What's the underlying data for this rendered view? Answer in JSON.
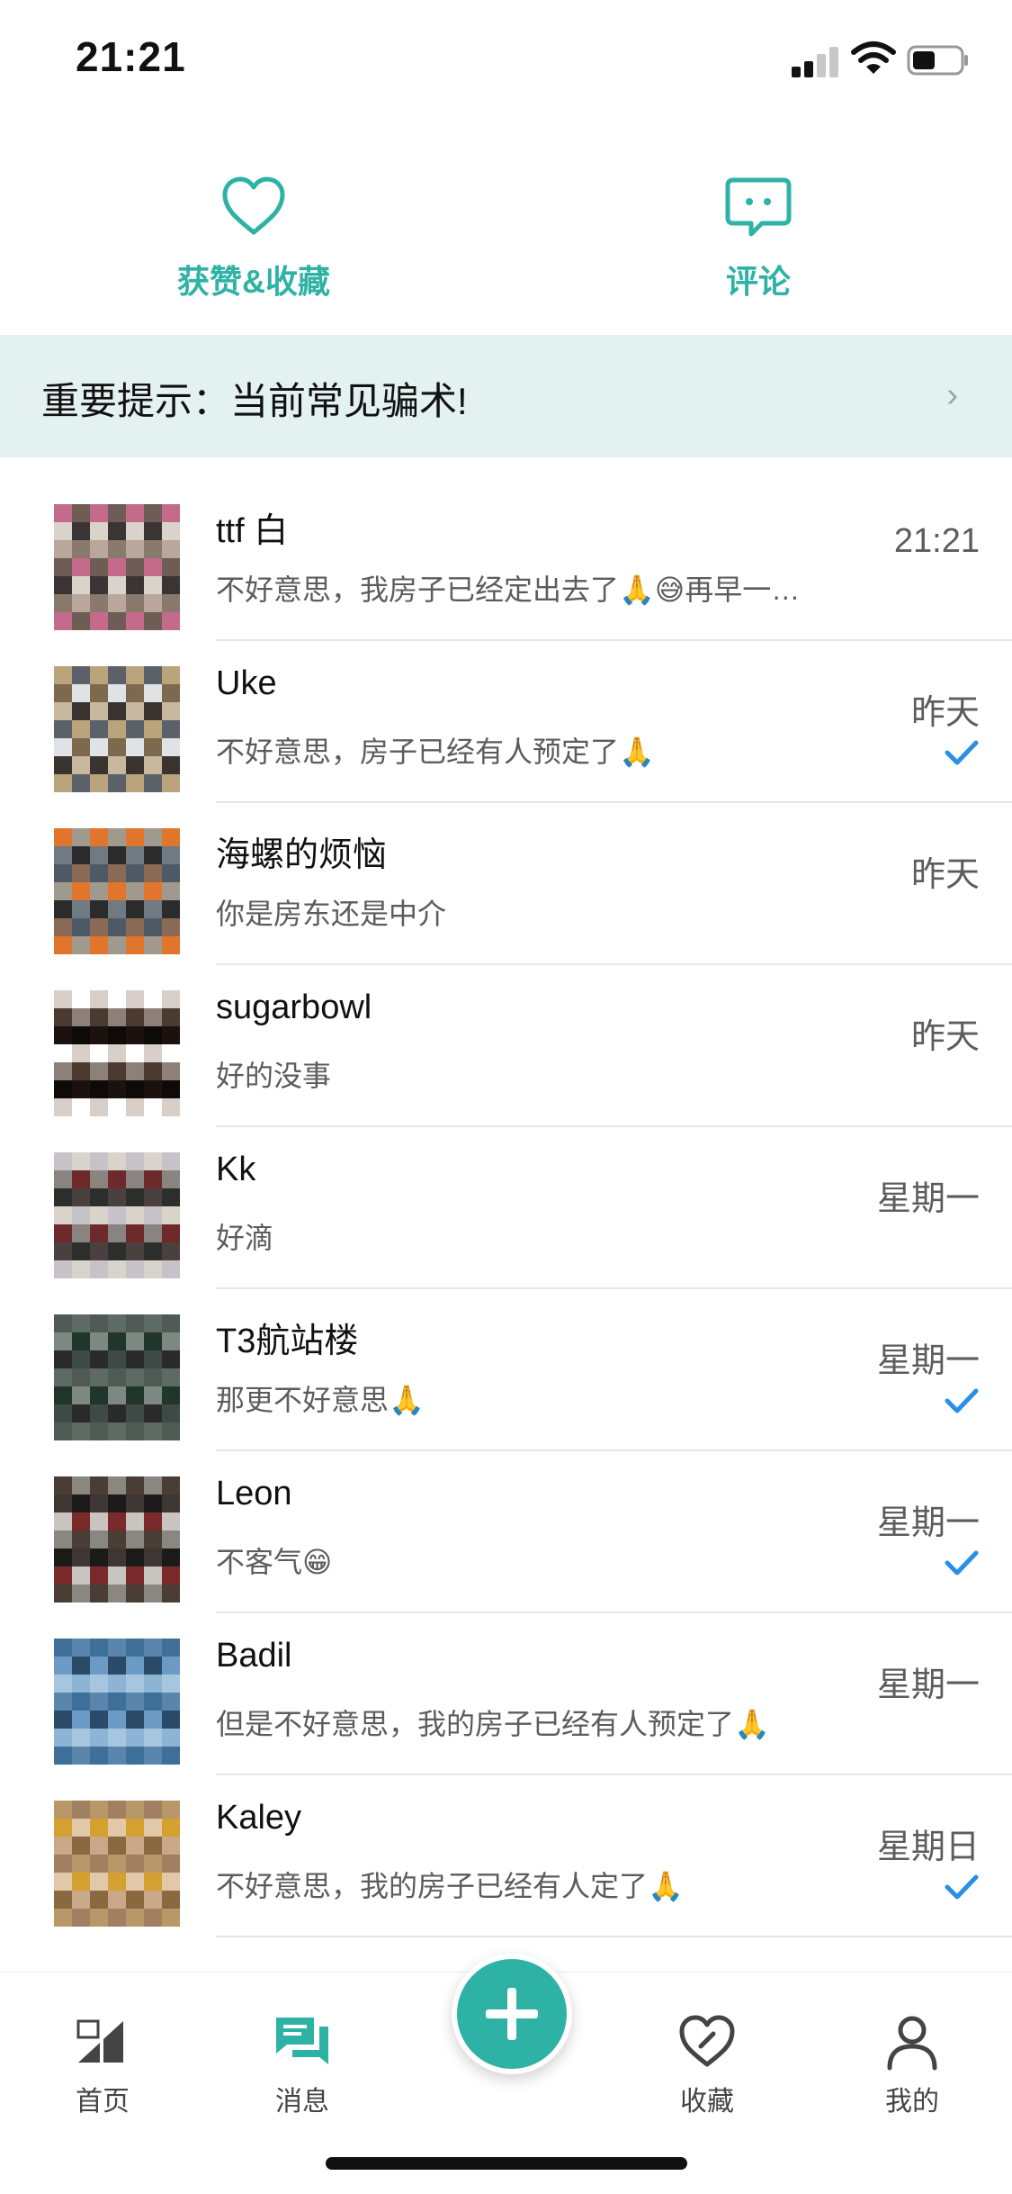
{
  "status_bar": {
    "time": "21:21"
  },
  "top_tabs": [
    {
      "label": "获赞&收藏",
      "icon": "heart-outline-icon"
    },
    {
      "label": "评论",
      "icon": "comment-bubble-icon"
    }
  ],
  "notice": {
    "text": "重要提示：当前常见骗术!",
    "chevron_icon": "chevron-right-icon"
  },
  "conversations": [
    {
      "name": "ttf 白",
      "preview": "不好意思，我房子已经定出去了🙏😅再早一…",
      "time": "21:21",
      "read": false
    },
    {
      "name": "Uke",
      "preview": "不好意思，房子已经有人预定了🙏",
      "time": "昨天",
      "read": true
    },
    {
      "name": "海螺的烦恼",
      "preview": "你是房东还是中介",
      "time": "昨天",
      "read": false
    },
    {
      "name": "sugarbowl",
      "preview": "好的没事",
      "time": "昨天",
      "read": false
    },
    {
      "name": "Kk",
      "preview": "好滴",
      "time": "星期一",
      "read": false
    },
    {
      "name": "T3航站楼",
      "preview": "那更不好意思🙏",
      "time": "星期一",
      "read": true
    },
    {
      "name": "Leon",
      "preview": "不客气😁",
      "time": "星期一",
      "read": true
    },
    {
      "name": "Badil",
      "preview": "但是不好意思，我的房子已经有人预定了🙏",
      "time": "星期一",
      "read": false
    },
    {
      "name": "Kaley",
      "preview": "不好意思，我的房子已经有人定了🙏",
      "time": "星期日",
      "read": true
    }
  ],
  "bottom_nav": {
    "items": [
      {
        "label": "首页",
        "icon": "home-icon"
      },
      {
        "label": "消息",
        "icon": "message-icon"
      },
      {
        "label": "收藏",
        "icon": "favorite-heart-icon"
      },
      {
        "label": "我的",
        "icon": "profile-icon"
      }
    ],
    "fab_icon": "plus-icon"
  },
  "colors": {
    "accent": "#2fb2a6",
    "notice_bg": "#e4f1f1",
    "read_check": "#2a8fe6"
  }
}
